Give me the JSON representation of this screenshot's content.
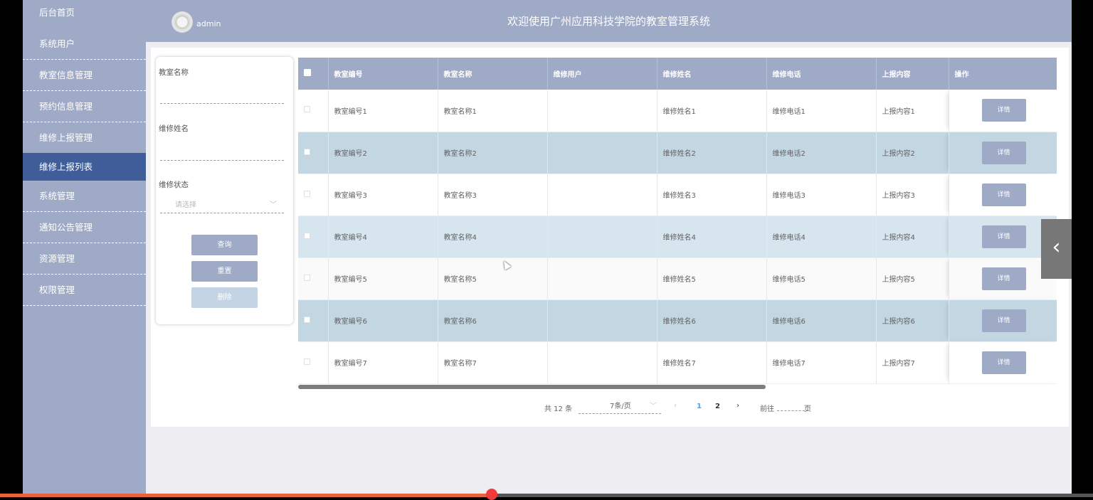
{
  "header": {
    "title": "欢迎使用广州应用科技学院的教室管理系统",
    "user": "admin"
  },
  "sidebar": {
    "items": [
      {
        "label": "后台首页"
      },
      {
        "label": "系统用户"
      },
      {
        "label": "教室信息管理"
      },
      {
        "label": "预约信息管理"
      },
      {
        "label": "维修上报管理"
      },
      {
        "label": "维修上报列表"
      },
      {
        "label": "系统管理"
      },
      {
        "label": "通知公告管理"
      },
      {
        "label": "资源管理"
      },
      {
        "label": "权限管理"
      }
    ],
    "active_index": 5
  },
  "search": {
    "room_name_label": "教室名称",
    "repair_name_label": "维修姓名",
    "status_label": "维修状态",
    "status_placeholder": "请选择",
    "query_button": "查询",
    "reset_button": "重置",
    "delete_button": "删除"
  },
  "table": {
    "columns": [
      "教室编号",
      "教室名称",
      "维修用户",
      "维修姓名",
      "维修电话",
      "上报内容",
      "操作"
    ],
    "rows": [
      {
        "code": "教室编号1",
        "name": "教室名称1",
        "user": "",
        "repairer": "维修姓名1",
        "phone": "维修电话1",
        "content": "上报内容1",
        "action": "详情"
      },
      {
        "code": "教室编号2",
        "name": "教室名称2",
        "user": "",
        "repairer": "维修姓名2",
        "phone": "维修电话2",
        "content": "上报内容2",
        "action": "详情"
      },
      {
        "code": "教室编号3",
        "name": "教室名称3",
        "user": "",
        "repairer": "维修姓名3",
        "phone": "维修电话3",
        "content": "上报内容3",
        "action": "详情"
      },
      {
        "code": "教室编号4",
        "name": "教室名称4",
        "user": "",
        "repairer": "维修姓名4",
        "phone": "维修电话4",
        "content": "上报内容4",
        "action": "详情"
      },
      {
        "code": "教室编号5",
        "name": "教室名称5",
        "user": "",
        "repairer": "维修姓名5",
        "phone": "维修电话5",
        "content": "上报内容5",
        "action": "详情"
      },
      {
        "code": "教室编号6",
        "name": "教室名称6",
        "user": "",
        "repairer": "维修姓名6",
        "phone": "维修电话6",
        "content": "上报内容6",
        "action": "详情"
      },
      {
        "code": "教室编号7",
        "name": "教室名称7",
        "user": "",
        "repairer": "维修姓名7",
        "phone": "维修电话7",
        "content": "上报内容7",
        "action": "详情"
      }
    ]
  },
  "pagination": {
    "total": "共 12 条",
    "page_size": "7条/页",
    "pages": [
      "1",
      "2"
    ],
    "current": "1",
    "goto_label": "前往",
    "page_word": "页"
  },
  "colors": {
    "theme": "#9eaac6",
    "active_nav": "#3f5e99",
    "row_highlight": "#c3d7e3",
    "current_page": "#409eff"
  },
  "video_progress": 0.45
}
